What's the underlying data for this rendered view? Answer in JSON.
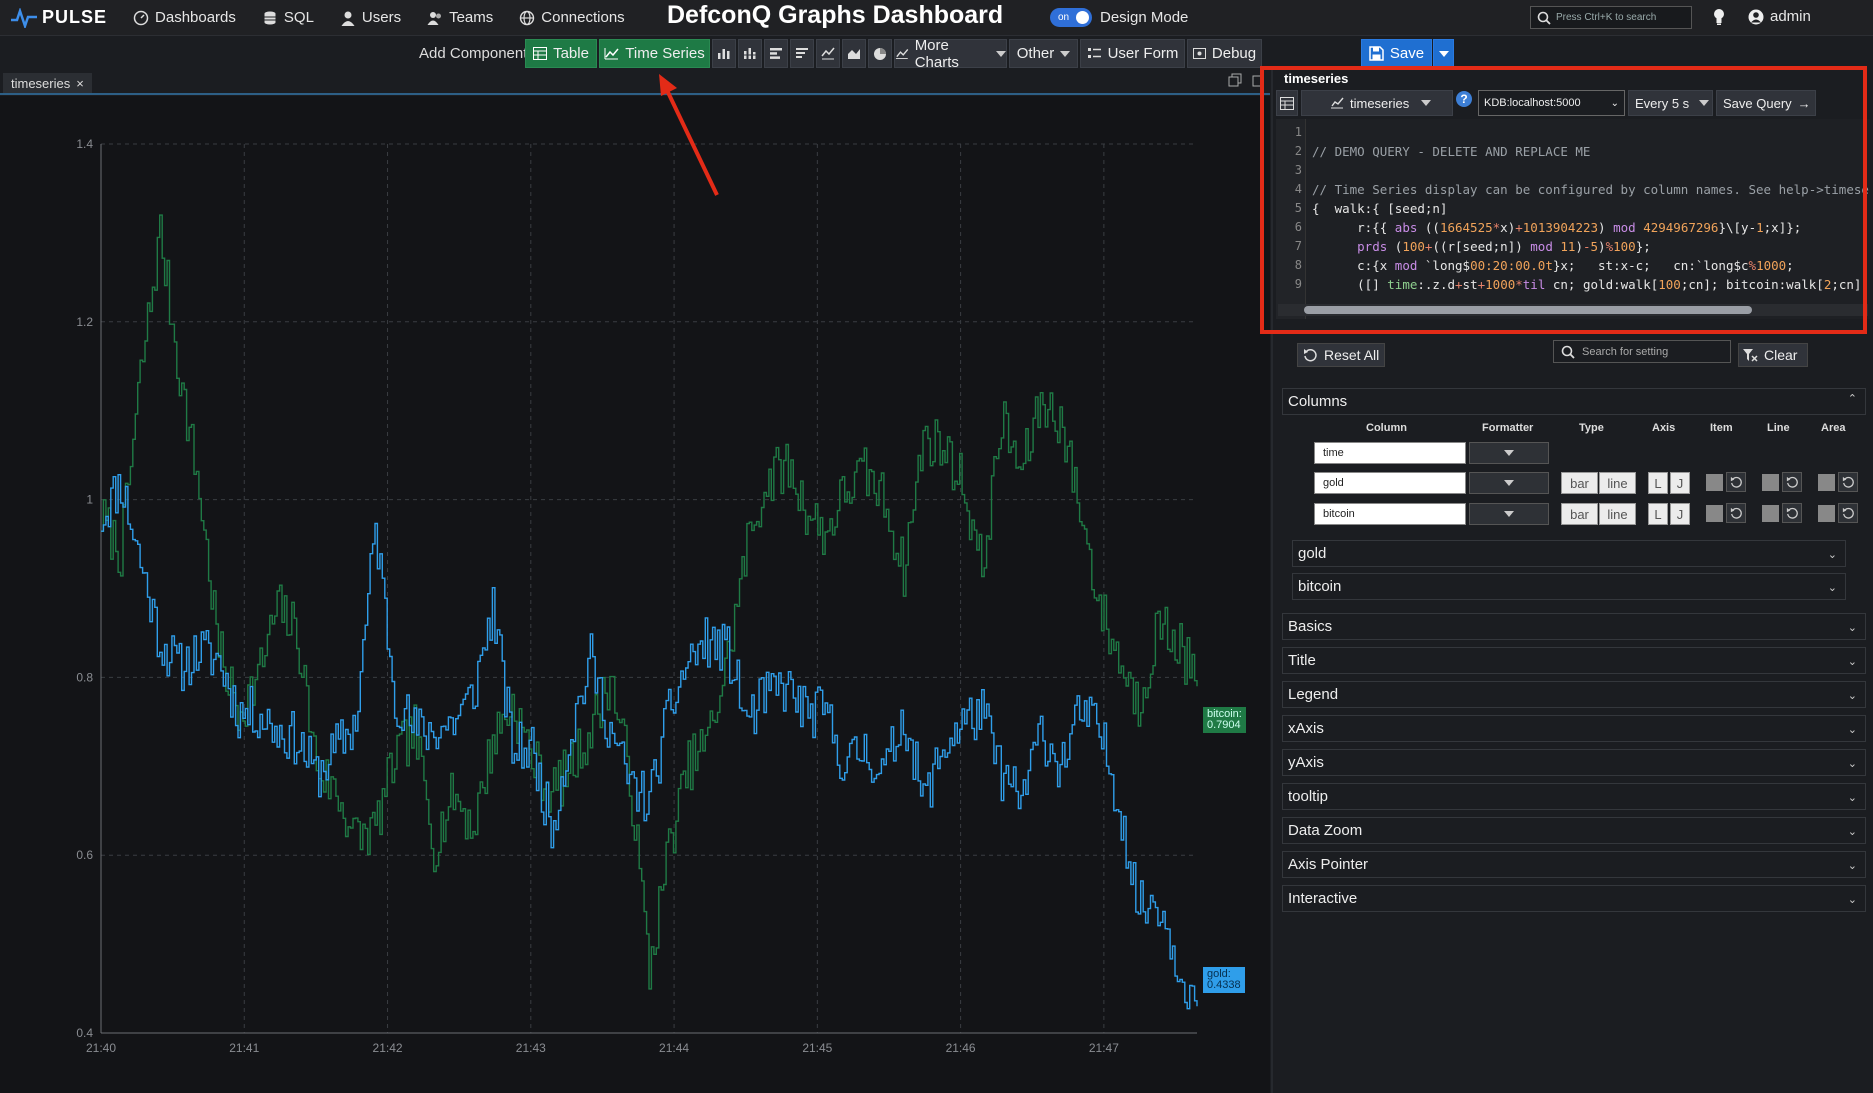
{
  "app": {
    "brand": "PULSE",
    "title": "DefconQ Graphs Dashboard",
    "design_mode_label": "Design Mode",
    "toggle_text": "on",
    "search_placeholder": "Press Ctrl+K to search",
    "user": "admin"
  },
  "nav": [
    "Dashboards",
    "SQL",
    "Users",
    "Teams",
    "Connections"
  ],
  "toolbar": {
    "add_label": "Add Component:",
    "table": "Table",
    "time_series": "Time Series",
    "more_charts": "More Charts",
    "other": "Other",
    "user_form": "User Form",
    "debug": "Debug",
    "save": "Save"
  },
  "tab": {
    "name": "timeseries",
    "close": "×"
  },
  "query": {
    "title": "timeseries",
    "chart_type": "timeseries",
    "server": "KDB:localhost:5000",
    "refresh": "Every 5 s",
    "save_query": "Save Query",
    "line_numbers": [
      "1",
      "2",
      "3",
      "4",
      "5",
      "6",
      "7",
      "8",
      "9"
    ]
  },
  "settings": {
    "reset_all": "Reset All",
    "search_placeholder": "Search for setting",
    "clear": "Clear",
    "columns_title": "Columns",
    "headers": [
      "Column",
      "Formatter",
      "Type",
      "Axis",
      "Item",
      "Line",
      "Area"
    ],
    "rows": [
      "time",
      "gold",
      "bitcoin"
    ],
    "type_bar": "bar",
    "type_line": "line",
    "axis_left": "L",
    "axis_right": "J",
    "groups": [
      "gold",
      "bitcoin"
    ],
    "sections": [
      "Basics",
      "Title",
      "Legend",
      "xAxis",
      "yAxis",
      "tooltip",
      "Data Zoom",
      "Axis Pointer",
      "Interactive"
    ]
  },
  "colors": {
    "gold_series": "#2f9eea",
    "bitcoin_series": "#1f7a45",
    "accent": "#1f6fd1",
    "highlight": "#e32b17"
  },
  "chart_data": {
    "type": "line",
    "x_ticks": [
      "21:40",
      "21:41",
      "21:42",
      "21:43",
      "21:44",
      "21:45",
      "21:46",
      "21:47"
    ],
    "y_ticks": [
      "1.4",
      "1.2",
      "1",
      "0.8",
      "0.6",
      "0.4"
    ],
    "ylim": [
      0.4,
      1.4
    ],
    "grid": true,
    "series": [
      {
        "name": "gold",
        "color": "#2f9eea",
        "end_label": "gold:",
        "end_value": "0.4338",
        "values": [
          0.98,
          1.02,
          0.93,
          0.84,
          0.81,
          0.83,
          0.82,
          0.76,
          0.76,
          0.74,
          0.73,
          0.69,
          0.72,
          0.75,
          0.97,
          0.78,
          0.74,
          0.74,
          0.75,
          0.78,
          0.88,
          0.72,
          0.72,
          0.63,
          0.74,
          0.82,
          0.74,
          0.68,
          0.66,
          0.76,
          0.82,
          0.84,
          0.83,
          0.75,
          0.78,
          0.79,
          0.76,
          0.76,
          0.7,
          0.72,
          0.69,
          0.76,
          0.66,
          0.72,
          0.75,
          0.76,
          0.69,
          0.66,
          0.74,
          0.7,
          0.76,
          0.74,
          0.66,
          0.54,
          0.55,
          0.48,
          0.43
        ]
      },
      {
        "name": "bitcoin",
        "color": "#1f7a45",
        "end_label": "bitcoin:",
        "end_value": "0.7904",
        "values": [
          0.98,
          0.94,
          1.14,
          1.3,
          1.14,
          1.01,
          0.83,
          0.76,
          0.8,
          0.88,
          0.85,
          0.7,
          0.67,
          0.62,
          0.63,
          0.71,
          0.74,
          0.61,
          0.67,
          0.63,
          0.73,
          0.77,
          0.71,
          0.67,
          0.7,
          0.74,
          0.8,
          0.69,
          0.47,
          0.61,
          0.7,
          0.73,
          0.82,
          0.95,
          1.02,
          1.04,
          0.99,
          0.96,
          1.01,
          1.03,
          1.0,
          0.92,
          1.07,
          1.06,
          1.02,
          0.92,
          1.09,
          1.03,
          1.11,
          1.09,
          0.99,
          0.88,
          0.82,
          0.77,
          0.86,
          0.84,
          0.79
        ]
      }
    ]
  }
}
